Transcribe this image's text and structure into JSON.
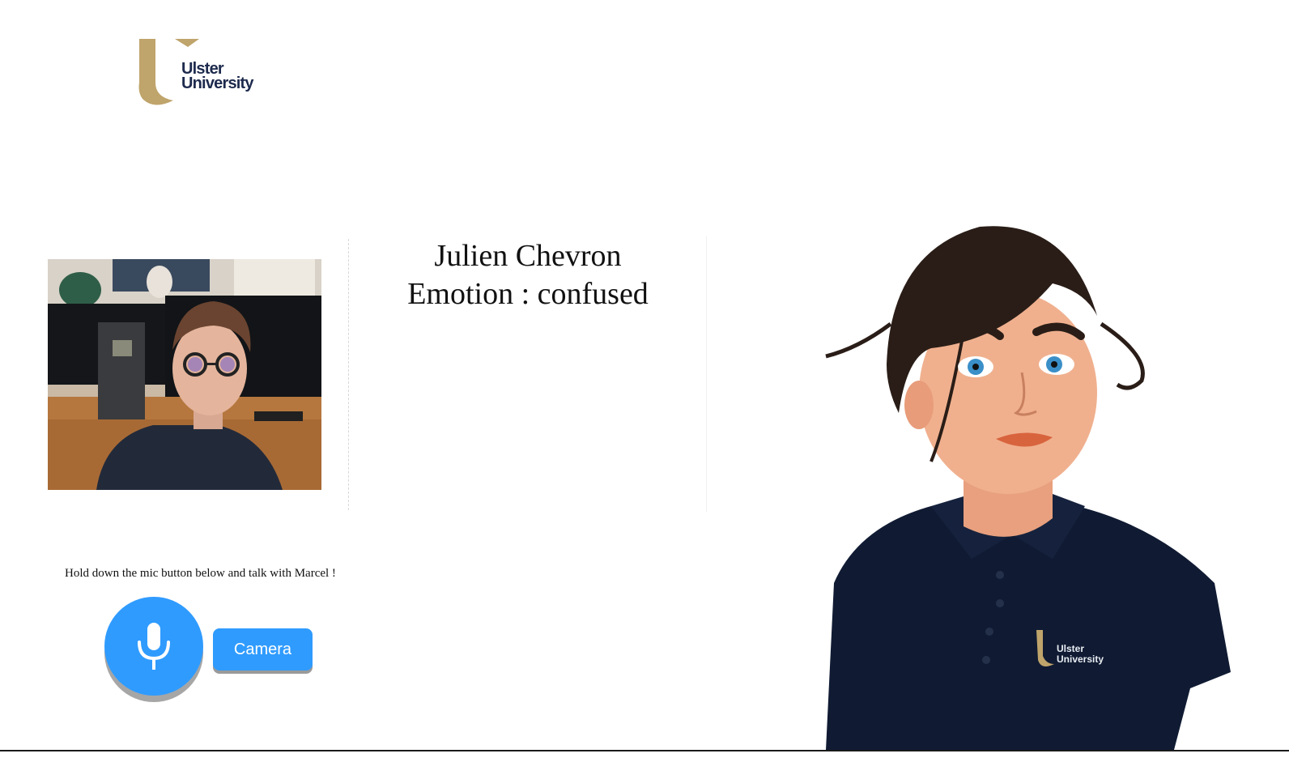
{
  "logo": {
    "line1": "Ulster",
    "line2": "University",
    "colors": {
      "gold": "#bfa46b",
      "navy": "#1d2a4d"
    }
  },
  "user": {
    "name": "Julien Chevron",
    "emotion_text": "Emotion : confused"
  },
  "instructions": "Hold down the mic button below and talk with Marcel !",
  "buttons": {
    "mic_icon": "microphone-icon",
    "camera_label": "Camera",
    "accent": "#2f9bff"
  },
  "avatar": {
    "shirt_logo_line1": "Ulster",
    "shirt_logo_line2": "University"
  }
}
